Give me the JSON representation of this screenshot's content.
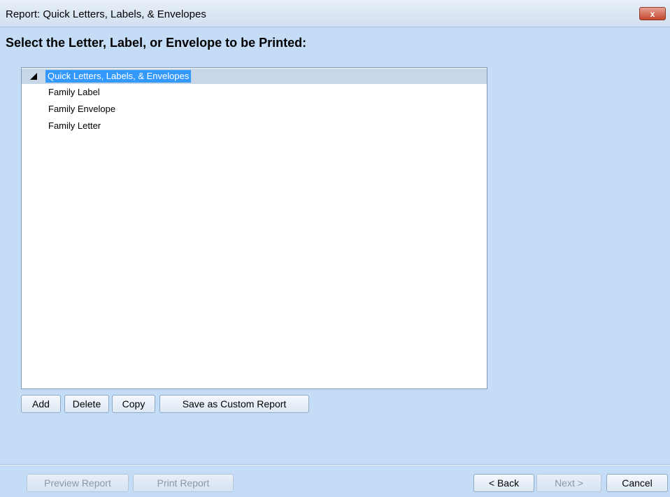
{
  "window": {
    "title": "Report:  Quick Letters, Labels, & Envelopes",
    "close_label": "x"
  },
  "heading": "Select the Letter, Label, or Envelope to be Printed:",
  "tree": {
    "root": "Quick Letters, Labels, & Envelopes",
    "items": [
      "Family Label",
      "Family Envelope",
      "Family Letter"
    ]
  },
  "actions": {
    "add": "Add",
    "delete": "Delete",
    "copy": "Copy",
    "save_custom": "Save as Custom Report"
  },
  "footer": {
    "preview": "Preview Report",
    "print": "Print Report",
    "back": "< Back",
    "next": "Next >",
    "cancel": "Cancel"
  },
  "colors": {
    "background": "#c5dcf6",
    "selection": "#3399ff",
    "root_row": "#c8d7e8"
  }
}
